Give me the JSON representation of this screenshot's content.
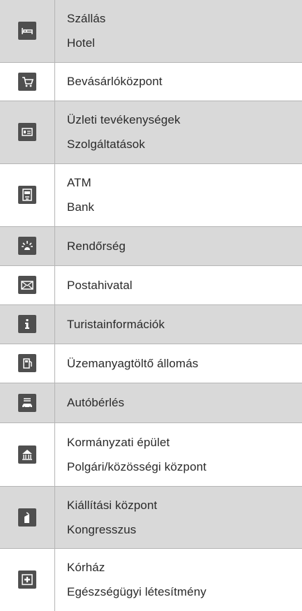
{
  "rows": [
    {
      "icon": "bed-icon",
      "lines": [
        "Szállás",
        "Hotel"
      ]
    },
    {
      "icon": "shopping-cart-icon",
      "lines": [
        "Bevásárlóközpont"
      ]
    },
    {
      "icon": "business-card-icon",
      "lines": [
        "Üzleti tevékenységek",
        "Szolgáltatások"
      ]
    },
    {
      "icon": "atm-icon",
      "lines": [
        "ATM",
        "Bank"
      ]
    },
    {
      "icon": "police-siren-icon",
      "lines": [
        "Rendőrség"
      ]
    },
    {
      "icon": "envelope-icon",
      "lines": [
        "Postahivatal"
      ]
    },
    {
      "icon": "info-icon",
      "lines": [
        "Turistainformációk"
      ]
    },
    {
      "icon": "fuel-pump-icon",
      "lines": [
        "Üzemanyagtöltő állomás"
      ]
    },
    {
      "icon": "car-rental-icon",
      "lines": [
        "Autóbérlés"
      ]
    },
    {
      "icon": "government-building-icon",
      "lines": [
        "Kormányzati épület",
        "Polgári/közösségi központ"
      ]
    },
    {
      "icon": "exhibition-icon",
      "lines": [
        "Kiállítási központ",
        "Kongresszus"
      ]
    },
    {
      "icon": "hospital-cross-icon",
      "lines": [
        "Kórház",
        "Egészségügyi létesítmény"
      ]
    }
  ]
}
